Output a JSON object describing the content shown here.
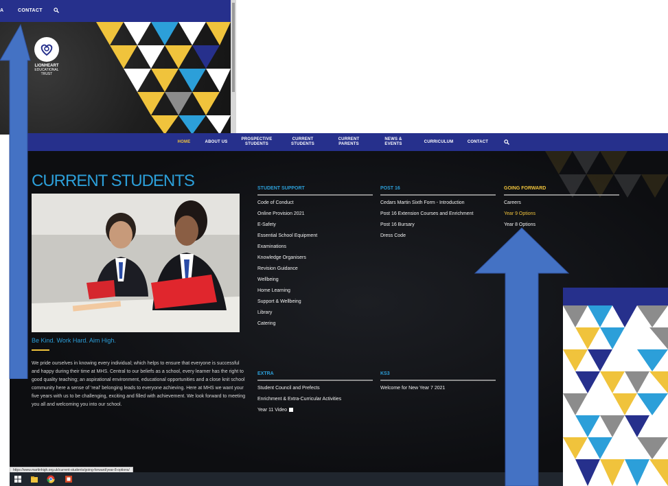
{
  "background_shot": {
    "nav": {
      "partial": "A",
      "contact": "CONTACT",
      "search_icon": "search-icon"
    },
    "logo": {
      "name": "LIONHEART",
      "sub_line1": "EDUCATIONAL",
      "sub_line2": "TRUST"
    }
  },
  "main_shot": {
    "nav": {
      "home": "HOME",
      "about": "ABOUT US",
      "prospective_1": "PROSPECTIVE",
      "prospective_2": "STUDENTS",
      "current_students_1": "CURRENT",
      "current_students_2": "STUDENTS",
      "current_parents_1": "CURRENT",
      "current_parents_2": "PARENTS",
      "news_1": "NEWS &",
      "news_2": "EVENTS",
      "curriculum": "CURRICULUM",
      "contact": "CONTACT",
      "search_icon": "search-icon"
    },
    "heading": "CURRENT STUDENTS",
    "tagline": "Be Kind. Work Hard. Aim High.",
    "intro": "We pride ourselves in knowing every individual; which helps to ensure that everyone is successful and happy during their time at MHS. Central to our beliefs as a school, every learner has the right to good quality teaching; an aspirational environment, educational opportunities and a close knit school community here a sense of 'real' belonging leads to everyone achieving. Here at MHS we want your five years with us to be challenging, exciting and filled with achievement. We look forward to meeting you all and welcoming you into our school.",
    "student_support": {
      "title": "STUDENT SUPPORT",
      "items": [
        "Code of Conduct",
        "Online Provision 2021",
        "E-Safety",
        "Essential School Equipment",
        "Examinations",
        "Knowledge Organisers",
        "Revision Guidance",
        "Wellbeing",
        "Home Learning",
        "Support & Wellbeing",
        "Library",
        "Catering"
      ]
    },
    "post16": {
      "title": "POST 16",
      "items": [
        "Cedars Martin Sixth Form - Introduction",
        "Post 16 Extension Courses and Enrichment",
        "Post 16 Bursary",
        "Dress Code"
      ]
    },
    "going_forward": {
      "title": "GOING FORWARD",
      "items": [
        "Careers",
        "Year 9 Options",
        "Year 8 Options"
      ]
    },
    "extra": {
      "title": "EXTRA",
      "items": [
        "Student Council and Prefects",
        "Enrichment & Extra-Curricular Activities",
        "Year 11 Video"
      ]
    },
    "ks3": {
      "title": "KS3",
      "items": [
        "Welcome for New Year 7 2021"
      ]
    },
    "status_url": "https://www.martinhigh.org.uk/current-students/going-forward/year-8-options/"
  },
  "colors": {
    "brand_navy": "#26308c",
    "accent_blue": "#2c9fd9",
    "accent_yellow": "#f0c33c",
    "arrow_blue": "#4472c4"
  }
}
